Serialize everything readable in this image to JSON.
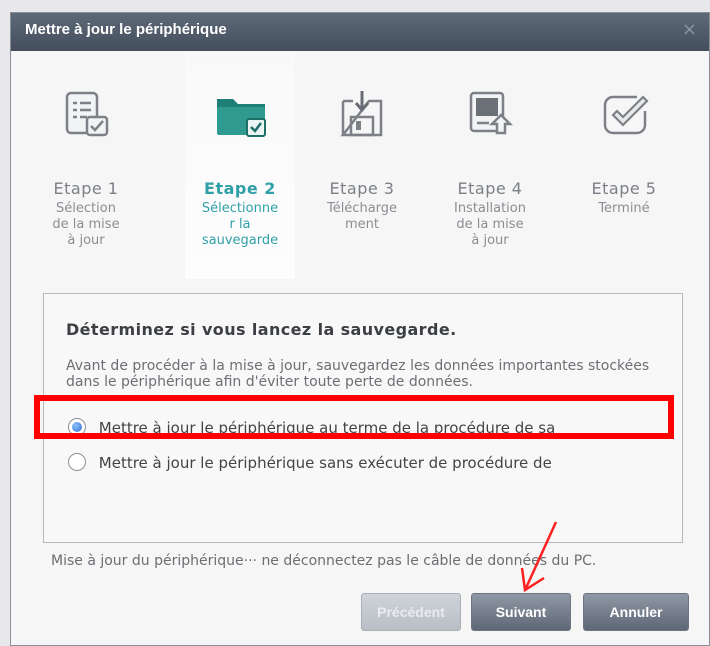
{
  "window": {
    "title": "Mettre à jour le périphérique",
    "close_glyph": "×"
  },
  "steps": [
    {
      "label": "Etape 1",
      "desc": "Sélection\nde la mise\nà jour",
      "icon": "checklist-document-icon"
    },
    {
      "label": "Etape 2",
      "desc": "Sélectionne\nr la\nsauvegarde",
      "icon": "folder-check-icon",
      "active": true
    },
    {
      "label": "Etape 3",
      "desc": "Télécharge\nment",
      "icon": "download-floppy-icon"
    },
    {
      "label": "Etape 4",
      "desc": "Installation\nde la mise\nà jour",
      "icon": "device-upload-icon"
    },
    {
      "label": "Etape 5",
      "desc": "Terminé",
      "icon": "checkmark-finish-icon"
    }
  ],
  "panel": {
    "heading": "Déterminez si vous lancez la sauvegarde.",
    "paragraph": "Avant de procéder à la mise à jour, sauvegardez les données importantes stockées dans le périphérique afin d'éviter toute perte de données.",
    "options": [
      {
        "label": "Mettre à jour le périphérique au terme de la procédure de sa",
        "selected": true
      },
      {
        "label": "Mettre à jour le périphérique sans exécuter de procédure de",
        "selected": false
      }
    ]
  },
  "status_text": "Mise à jour du périphérique··· ne déconnectez pas le câble de données du PC.",
  "buttons": {
    "previous": "Précédent",
    "next": "Suivant",
    "cancel": "Annuler"
  },
  "colors": {
    "accent": "#30a0a8",
    "highlight": "#ff0000"
  }
}
